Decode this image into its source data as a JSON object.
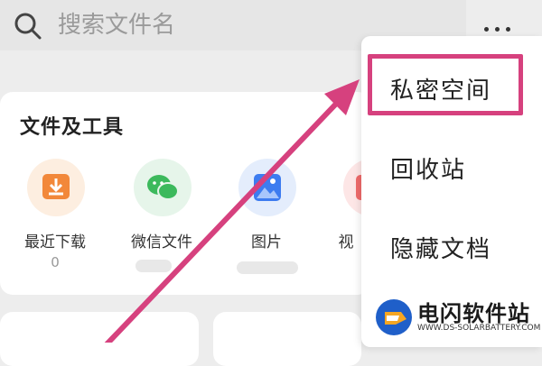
{
  "search": {
    "placeholder": "搜索文件名"
  },
  "card": {
    "title": "文件及工具",
    "tools": [
      {
        "label": "最近下载",
        "count": "0",
        "icon": "download-icon",
        "color": "#f2883a",
        "bg": "#fdeee0"
      },
      {
        "label": "微信文件",
        "icon": "wechat-icon",
        "color": "#3cb95c",
        "bg": "#e6f5ea"
      },
      {
        "label": "图片",
        "icon": "image-icon",
        "color": "#3d7cf0",
        "bg": "#e4edfc"
      },
      {
        "label": "视",
        "icon": "video-icon",
        "color": "#ef6a6a",
        "bg": "#fde6e6"
      }
    ]
  },
  "menu": {
    "items": [
      {
        "label": "私密空间"
      },
      {
        "label": "回收站"
      },
      {
        "label": "隐藏文档"
      }
    ]
  },
  "watermark": {
    "title": "电闪软件站",
    "url": "WWW.DS-SOLARBATTERY.COM"
  },
  "colors": {
    "highlight": "#d6417e",
    "arrow": "#d6417e"
  }
}
